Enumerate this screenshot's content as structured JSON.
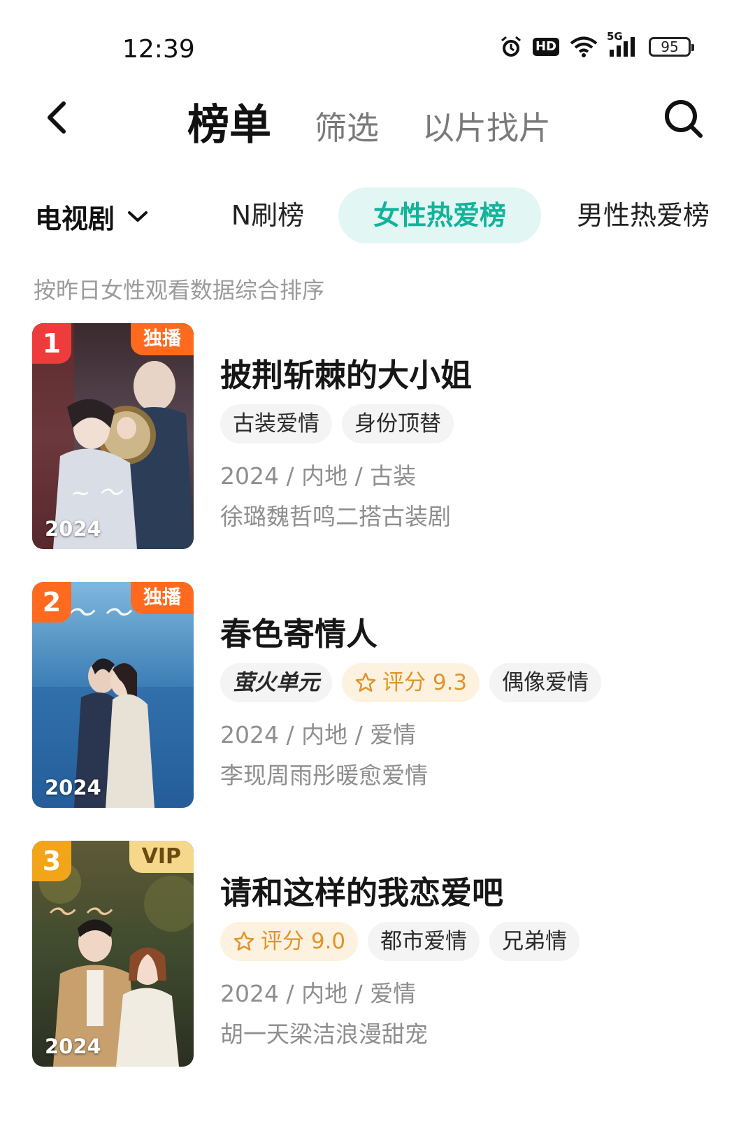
{
  "status_bar": {
    "time": "12:39",
    "network_label": "5G",
    "hd_label": "HD",
    "battery": "95",
    "icons": [
      "alarm-icon",
      "hd-icon",
      "wifi-icon",
      "signal-icon",
      "battery-icon"
    ]
  },
  "header": {
    "tabs": [
      {
        "label": "榜单",
        "active": true
      },
      {
        "label": "筛选",
        "active": false
      },
      {
        "label": "以片找片",
        "active": false
      }
    ],
    "icons": [
      "back-icon",
      "search-icon"
    ]
  },
  "category": {
    "dropdown_label": "电视剧",
    "rank_tabs": [
      {
        "label": "N刷榜",
        "active": false
      },
      {
        "label": "女性热爱榜",
        "active": true
      },
      {
        "label": "男性热爱榜",
        "active": false
      }
    ]
  },
  "sort_note": "按昨日女性观看数据综合排序",
  "items": [
    {
      "rank": "1",
      "badge": "独播",
      "poster_year": "2024",
      "title": "披荆斩棘的大小姐",
      "chips": [
        {
          "label": "古装爱情",
          "type": "plain"
        },
        {
          "label": "身份顶替",
          "type": "plain"
        }
      ],
      "meta": "2024 / 内地 / 古装",
      "desc": "徐璐魏哲鸣二搭古装剧"
    },
    {
      "rank": "2",
      "badge": "独播",
      "poster_year": "2024",
      "title": "春色寄情人",
      "chips": [
        {
          "label": "萤火单元",
          "type": "brand"
        },
        {
          "label": "评分 9.3",
          "type": "rating"
        },
        {
          "label": "偶像爱情",
          "type": "plain"
        }
      ],
      "meta": "2024 / 内地 / 爱情",
      "desc": "李现周雨彤暖愈爱情"
    },
    {
      "rank": "3",
      "badge": "VIP",
      "poster_year": "2024",
      "title": "请和这样的我恋爱吧",
      "chips": [
        {
          "label": "评分 9.0",
          "type": "rating"
        },
        {
          "label": "都市爱情",
          "type": "plain"
        },
        {
          "label": "兄弟情",
          "type": "plain"
        }
      ],
      "meta": "2024 / 内地 / 爱情",
      "desc": "胡一天梁洁浪漫甜宠"
    }
  ],
  "colors": {
    "accent": "#12b39b",
    "accent_bg": "#e2f6f3",
    "rank1": "#ee3b3b",
    "rank2": "#ff6a1f",
    "rank3": "#f3a51a",
    "exclusive": "#ff6a1f",
    "rating": "#e0942a"
  }
}
